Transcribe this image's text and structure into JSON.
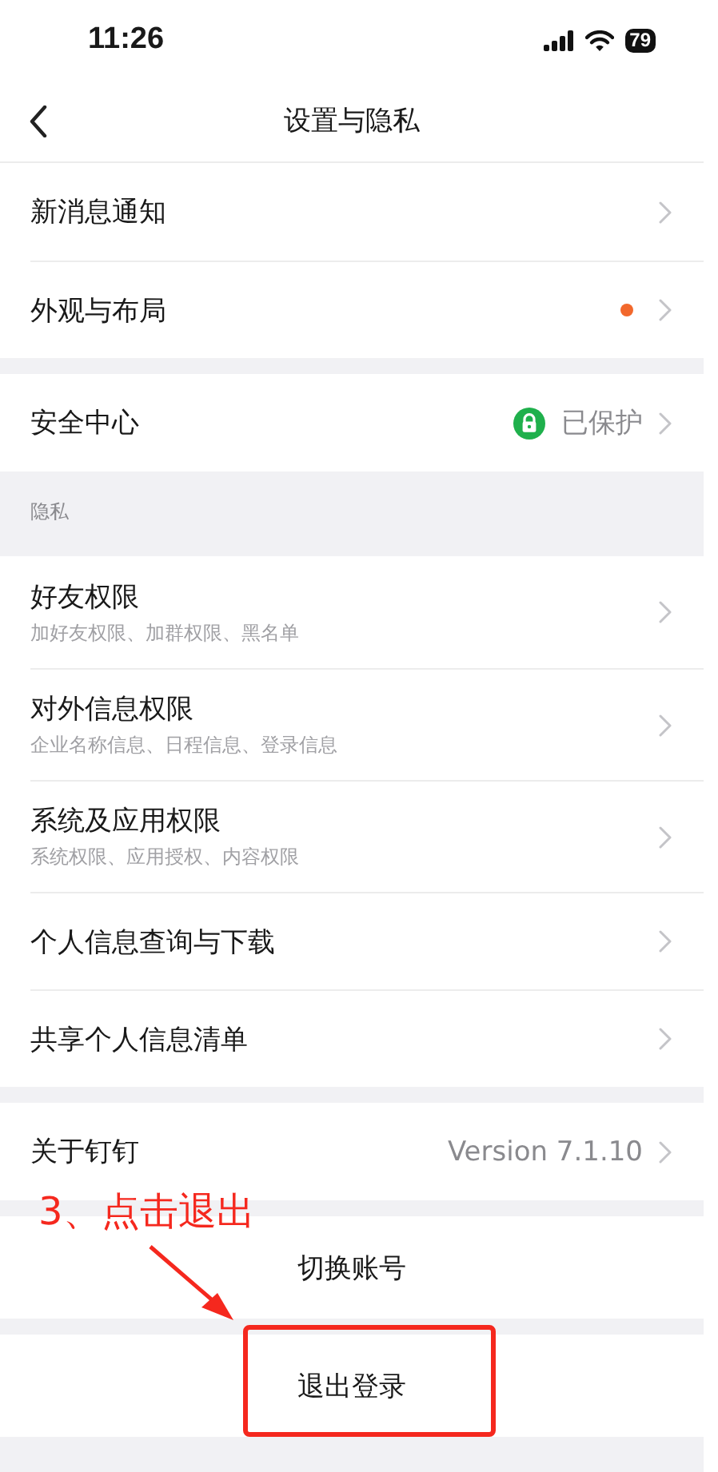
{
  "status_bar": {
    "time": "11:26",
    "battery": "79"
  },
  "nav": {
    "title": "设置与隐私"
  },
  "groups": [
    {
      "items": [
        {
          "kind": "plain",
          "label": "新消息通知"
        },
        {
          "kind": "dot",
          "label": "外观与布局"
        }
      ]
    },
    {
      "items": [
        {
          "kind": "secure",
          "label": "安全中心",
          "value": "已保护"
        }
      ]
    },
    {
      "header": "隐私",
      "items": [
        {
          "kind": "with_sub",
          "label": "好友权限",
          "subtitle": "加好友权限、加群权限、黑名单"
        },
        {
          "kind": "with_sub",
          "label": "对外信息权限",
          "subtitle": "企业名称信息、日程信息、登录信息"
        },
        {
          "kind": "with_sub",
          "label": "系统及应用权限",
          "subtitle": "系统权限、应用授权、内容权限"
        },
        {
          "kind": "plain",
          "label": "个人信息查询与下载"
        },
        {
          "kind": "plain",
          "label": "共享个人信息清单"
        }
      ]
    },
    {
      "items": [
        {
          "kind": "value",
          "label": "关于钉钉",
          "value": "Version 7.1.10"
        }
      ]
    },
    {
      "items": [
        {
          "kind": "action",
          "label": "切换账号"
        }
      ]
    },
    {
      "items": [
        {
          "kind": "action",
          "label": "退出登录",
          "highlighted": true
        }
      ]
    }
  ],
  "annotation": {
    "text": "3、点击退出"
  }
}
